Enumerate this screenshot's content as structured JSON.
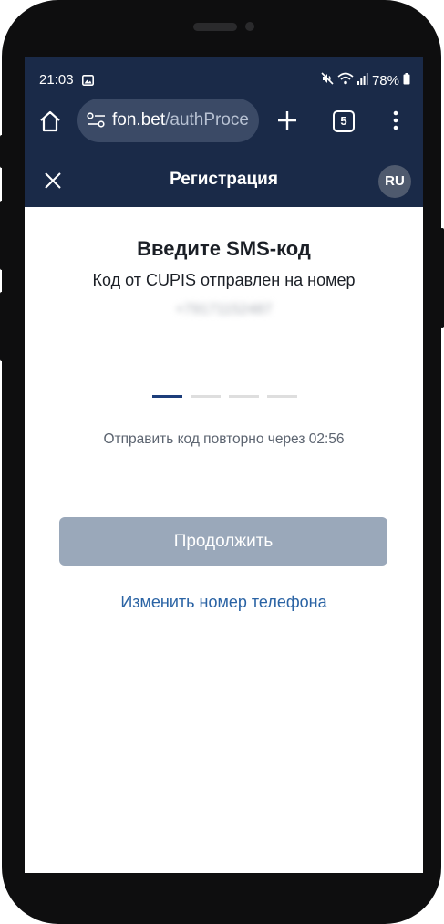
{
  "status_bar": {
    "time": "21:03",
    "battery": "78%"
  },
  "browser": {
    "url_domain": "fon.bet",
    "url_path": "/authProce",
    "tab_count": "5"
  },
  "app_bar": {
    "title": "Регистрация",
    "language": "RU"
  },
  "sms_form": {
    "heading": "Введите SMS-код",
    "subtitle": "Код от CUPIS отправлен на номер",
    "phone_number": "+79171152487",
    "code_length": 4,
    "resend_text": "Отправить код повторно через 02:56",
    "continue_label": "Продолжить",
    "change_phone_label": "Изменить номер телефона"
  },
  "colors": {
    "header_bg": "#1a2a48",
    "primary_disabled": "#9aa8ba",
    "link": "#2a63a4",
    "active_cell": "#1c3d7a"
  }
}
